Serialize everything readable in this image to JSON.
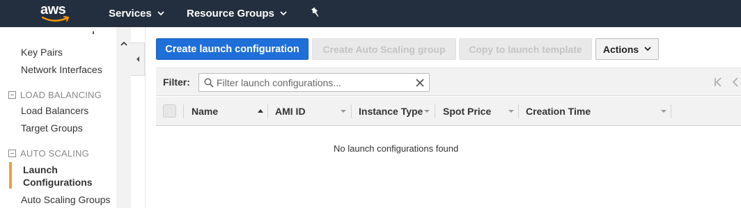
{
  "topnav": {
    "logo_text": "aws",
    "services_label": "Services",
    "resource_groups_label": "Resource Groups"
  },
  "sidebar": {
    "items_top": [
      {
        "label": "Key Pairs"
      },
      {
        "label": "Network Interfaces"
      }
    ],
    "sections": [
      {
        "title": "LOAD BALANCING",
        "items": [
          {
            "label": "Load Balancers"
          },
          {
            "label": "Target Groups"
          }
        ]
      },
      {
        "title": "AUTO SCALING",
        "items": [
          {
            "label": "Launch Configurations"
          },
          {
            "label": "Auto Scaling Groups"
          }
        ]
      }
    ],
    "active_item": "Launch Configurations"
  },
  "toolbar": {
    "create_label": "Create launch configuration",
    "create_asg_label": "Create Auto Scaling group",
    "copy_label": "Copy to launch template",
    "actions_label": "Actions"
  },
  "filter": {
    "label": "Filter:",
    "placeholder": "Filter launch configurations..."
  },
  "table": {
    "columns": [
      "Name",
      "AMI ID",
      "Instance Type",
      "Spot Price",
      "Creation Time"
    ],
    "sorted_column": "Name",
    "sort_direction": "ascending",
    "empty_message": "No launch configurations found"
  },
  "colors": {
    "nav_bg": "#232f3e",
    "primary": "#1f6fd8",
    "active_accent": "#f29d38"
  }
}
